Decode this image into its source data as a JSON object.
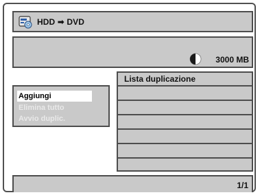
{
  "header": {
    "title": "HDD ➡ DVD",
    "icon": "hdd-dvd-icon"
  },
  "info": {
    "capacity": "3000 MB",
    "capacity_icon": "disc-capacity-pie-icon"
  },
  "menu": {
    "items": [
      {
        "label": "Aggiungi",
        "state": "selected"
      },
      {
        "label": "Elimina tutto",
        "state": "disabled"
      },
      {
        "label": "Avvio duplic.",
        "state": "disabled"
      }
    ]
  },
  "duplication_list": {
    "header": "Lista duplicazione",
    "rows": [
      "",
      "",
      "",
      "",
      "",
      ""
    ]
  },
  "footer": {
    "page": "1/1"
  },
  "colors": {
    "panel": "#c9c9c9",
    "border": "#4d4d4d",
    "disabled_text": "#e9e9e9",
    "selected_bg": "#ffffff"
  }
}
